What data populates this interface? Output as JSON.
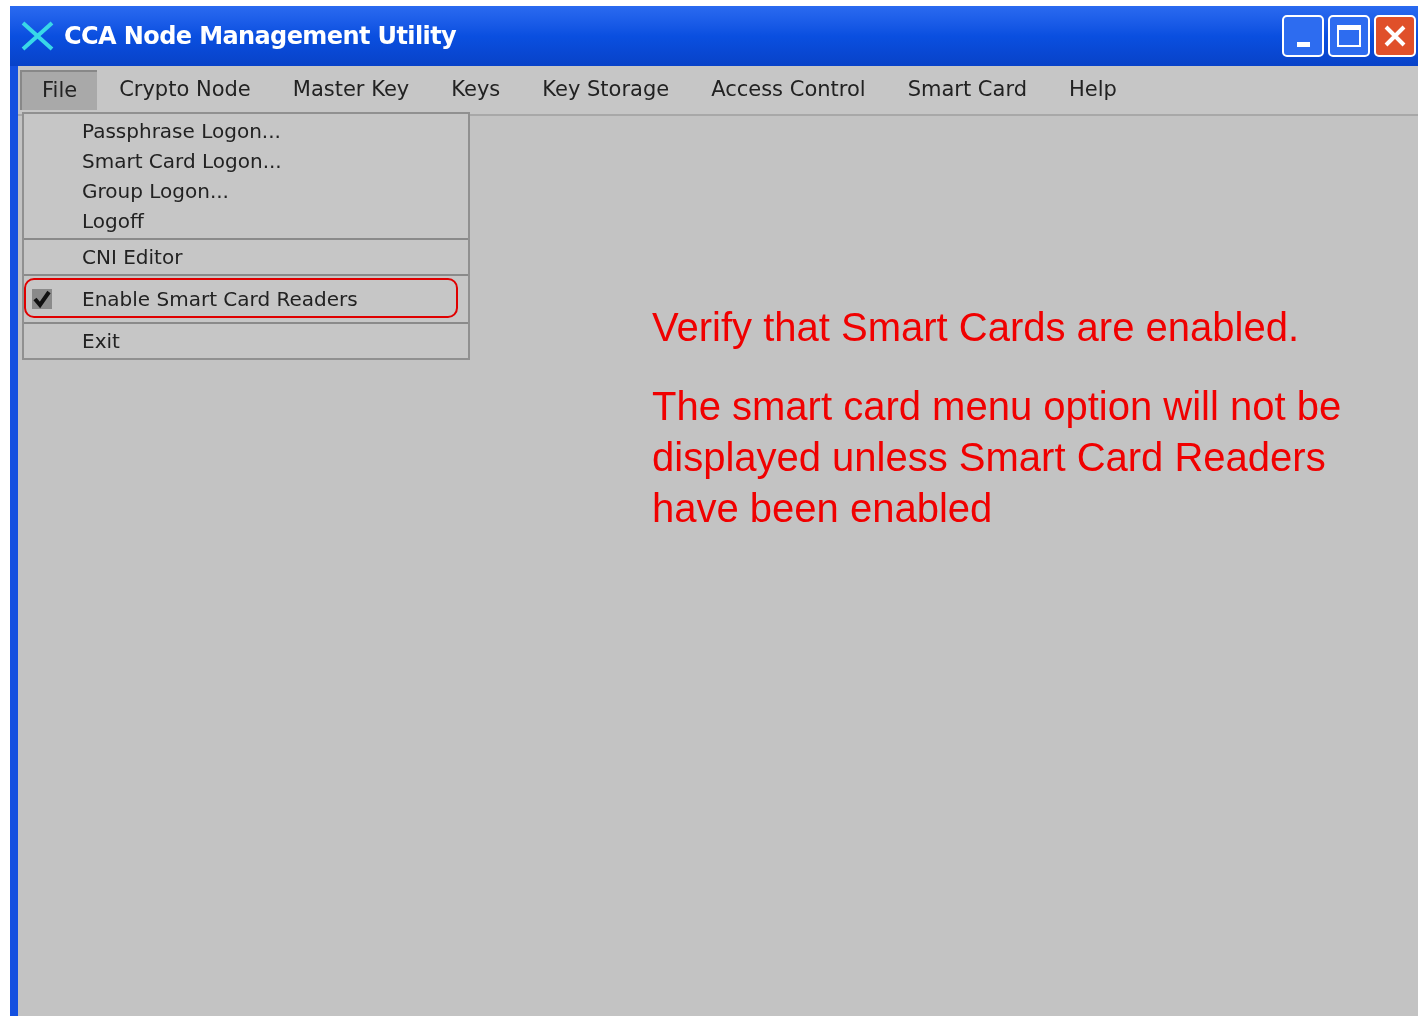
{
  "window": {
    "title": "CCA Node Management Utility"
  },
  "menubar": [
    {
      "label": "File",
      "selected": true
    },
    {
      "label": "Crypto Node",
      "selected": false
    },
    {
      "label": "Master Key",
      "selected": false
    },
    {
      "label": "Keys",
      "selected": false
    },
    {
      "label": "Key Storage",
      "selected": false
    },
    {
      "label": "Access Control",
      "selected": false
    },
    {
      "label": "Smart Card",
      "selected": false
    },
    {
      "label": "Help",
      "selected": false
    }
  ],
  "file_menu": [
    {
      "kind": "item",
      "label": "Passphrase Logon..."
    },
    {
      "kind": "item",
      "label": "Smart Card Logon..."
    },
    {
      "kind": "item",
      "label": "Group Logon..."
    },
    {
      "kind": "item",
      "label": "Logoff"
    },
    {
      "kind": "separator"
    },
    {
      "kind": "item",
      "label": "CNI Editor"
    },
    {
      "kind": "separator"
    },
    {
      "kind": "check",
      "label": "Enable Smart Card Readers",
      "checked": true,
      "highlighted": true
    },
    {
      "kind": "separator"
    },
    {
      "kind": "item",
      "label": "Exit"
    }
  ],
  "annotations": [
    "Verify that Smart Cards are enabled.",
    "The smart card menu option will not be displayed unless Smart Card Readers have been enabled"
  ]
}
